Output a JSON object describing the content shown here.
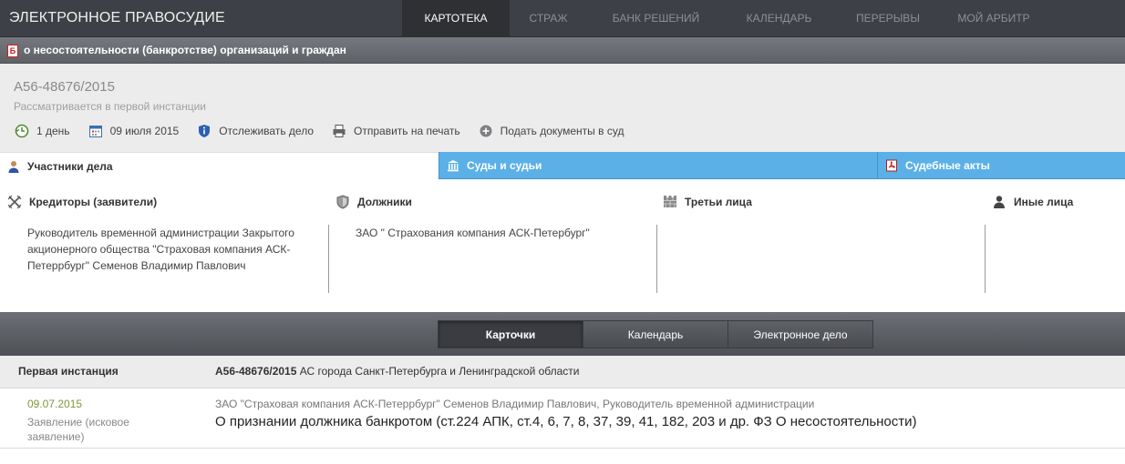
{
  "header": {
    "brand": "ЭЛЕКТРОННОЕ ПРАВОСУДИЕ",
    "nav": [
      "КАРТОТЕКА",
      "СТРАЖ",
      "БАНК РЕШЕНИЙ",
      "КАЛЕНДАРЬ",
      "ПЕРЕРЫВЫ",
      "МОЙ АРБИТР"
    ],
    "active_nav": "КАРТОТЕКА"
  },
  "case_type": {
    "badge": "Б",
    "label": "о несостоятельности (банкротстве) организаций и граждан"
  },
  "case": {
    "number": "А56-48676/2015",
    "status": "Рассматривается в первой инстанции",
    "actions": [
      {
        "icon": "clock-back-icon",
        "label": "1 день"
      },
      {
        "icon": "calendar-icon",
        "label": "09 июля 2015"
      },
      {
        "icon": "shield-info-icon",
        "label": "Отслеживать дело"
      },
      {
        "icon": "printer-icon",
        "label": "Отправить на печать"
      },
      {
        "icon": "plus-circle-icon",
        "label": "Подать документы в суд"
      }
    ]
  },
  "tabs": [
    {
      "icon": "person-icon",
      "label": "Участники дела"
    },
    {
      "icon": "courthouse-icon",
      "label": "Суды и судьи"
    },
    {
      "icon": "pdf-icon",
      "label": "Судебные акты"
    }
  ],
  "participants": {
    "creditors": {
      "title": "Кредиторы (заявители)",
      "icon": "crossed-swords-icon",
      "lines": [
        "Руководитель временной администрации Закрытого",
        "акционерного общества \"Страховая компания АСК-",
        "Петеррбург\" Семенов Владимир Павлович"
      ]
    },
    "debtors": {
      "title": "Должники",
      "icon": "shield-icon",
      "lines": [
        "ЗАО \" Страхования компания АСК-Петербург\""
      ]
    },
    "third": {
      "title": "Третьи лица",
      "icon": "wall-icon"
    },
    "others": {
      "title": "Иные лица",
      "icon": "person-silhouette-icon"
    }
  },
  "view_switch": {
    "buttons": [
      "Карточки",
      "Календарь",
      "Электронное дело"
    ],
    "active": "Карточки"
  },
  "instance": {
    "label": "Первая инстанция",
    "case_number": "А56-48676/2015",
    "court": "АС города Санкт-Петербурга и Ленинградской области"
  },
  "event": {
    "date": "09.07.2015",
    "type_line1": "Заявление (исковое",
    "type_line2": "заявление)",
    "who": "ЗАО \"Страховая компания АСК-Петеррбург\" Семенов Владимир Павлович, Руководитель временной администрации",
    "what": "О признании должника банкротом (ст.224 АПК, ст.4, 6, 7, 8, 37, 39, 41, 182, 203 и др. ФЗ О несостоятельности)"
  },
  "colors": {
    "topbar": "#3d4046",
    "tab_blue": "#5bb0e8",
    "date_green": "#7a9a3a"
  }
}
